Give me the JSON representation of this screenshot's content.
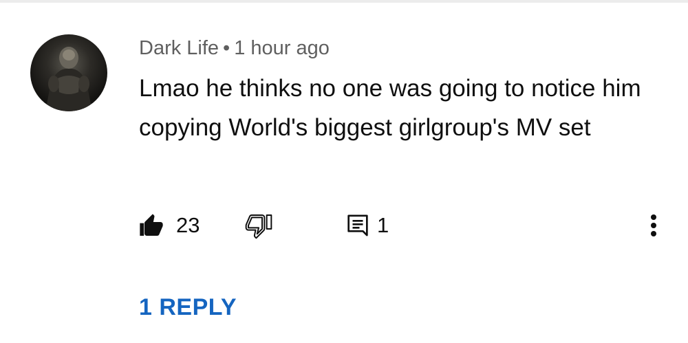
{
  "comment": {
    "author": "Dark Life",
    "separator": "•",
    "time": "1 hour ago",
    "text": "Lmao he thinks no one was going to notice him copying World's biggest girlgroup's MV set",
    "like_count": "23",
    "reply_count": "1",
    "view_replies_label": "1 REPLY",
    "avatar_icon": "avatar-image",
    "like_icon": "thumbs-up-filled-icon",
    "dislike_icon": "thumbs-down-outline-icon",
    "reply_icon": "comment-icon",
    "more_icon": "more-vertical-icon"
  },
  "colors": {
    "text_primary": "#0f0f0f",
    "text_secondary": "#5f5f5f",
    "link_blue": "#1565c0"
  }
}
